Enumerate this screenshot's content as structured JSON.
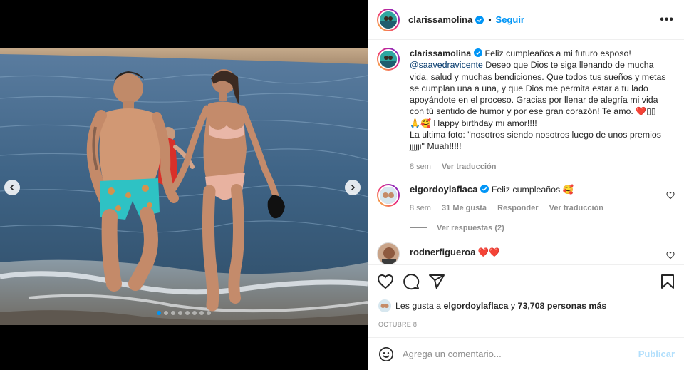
{
  "post": {
    "username": "clarissamolina",
    "follow_label": "Seguir",
    "separator": "•",
    "more_label": "•••"
  },
  "caption": {
    "username": "clarissamolina",
    "text_1": "Feliz cumpleaños a mi futuro esposo!",
    "mention": "@saavedravicente",
    "text_2": "Deseo que Dios te siga llenando de mucha vida, salud y muchas bendiciones. Que todos tus sueños y metas se cumplan una a una, y que Dios me permita estar a tu lado apoyándote en el proceso. Gracias por llenar de alegría mi vida con tú sentido de humor y por ese gran corazón! Te amo.",
    "emoji_1": "❤️▯▯",
    "emoji_2": "🙏🥰",
    "text_3": "Happy birthday mi amor!!!!",
    "text_4": "La ultima foto: \"nosotros siendo nosotros luego de unos premios jjjjji\" Muah!!!!!",
    "age": "8 sem",
    "translate": "Ver traducción"
  },
  "comments": [
    {
      "username": "elgordoylaflaca",
      "text": "Feliz cumpleaños 🥰",
      "age": "8 sem",
      "likes": "31 Me gusta",
      "reply": "Responder",
      "translate": "Ver traducción",
      "replies": "Ver respuestas (2)"
    },
    {
      "username": "rodnerfigueroa",
      "text": "❤️❤️"
    }
  ],
  "likes": {
    "prefix": "Les gusta a",
    "user": "elgordoylaflaca",
    "middle": "y",
    "count": "73,708 personas más"
  },
  "date": "OCTUBRE 8",
  "add_comment": {
    "placeholder": "Agrega un comentario...",
    "publish": "Publicar"
  },
  "carousel": {
    "total": 8,
    "active_index": 0
  },
  "colors": {
    "accent": "#0095f6",
    "heart": "#ed4956",
    "publish_disabled": "#b2dffc"
  },
  "icons": [
    "verified-badge-icon",
    "heart-icon",
    "comment-icon",
    "share-icon",
    "bookmark-icon",
    "emoji-icon",
    "chevron-left-icon",
    "chevron-right-icon"
  ]
}
